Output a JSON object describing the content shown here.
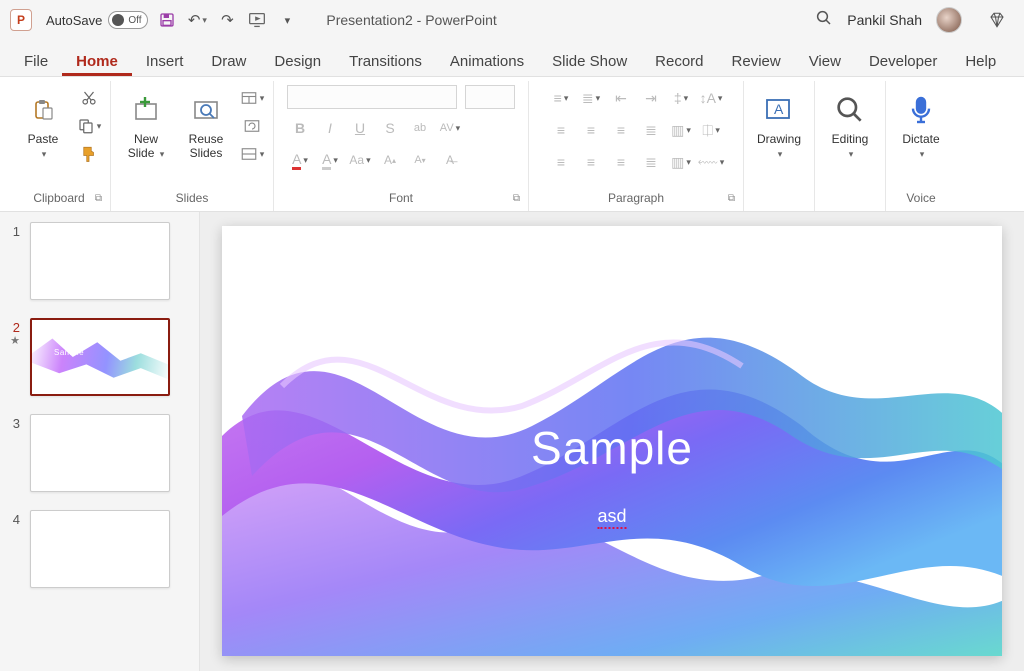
{
  "titlebar": {
    "autosave_label": "AutoSave",
    "autosave_state": "Off",
    "doc_title": "Presentation2  -  PowerPoint",
    "user_name": "Pankil Shah"
  },
  "tabs": [
    {
      "label": "File"
    },
    {
      "label": "Home",
      "active": true
    },
    {
      "label": "Insert"
    },
    {
      "label": "Draw"
    },
    {
      "label": "Design"
    },
    {
      "label": "Transitions"
    },
    {
      "label": "Animations"
    },
    {
      "label": "Slide Show"
    },
    {
      "label": "Record"
    },
    {
      "label": "Review"
    },
    {
      "label": "View"
    },
    {
      "label": "Developer"
    },
    {
      "label": "Help"
    }
  ],
  "ribbon": {
    "clipboard": {
      "paste": "Paste",
      "group_label": "Clipboard"
    },
    "slides": {
      "new_slide": "New\nSlide",
      "reuse": "Reuse\nSlides",
      "group_label": "Slides"
    },
    "font": {
      "group_label": "Font"
    },
    "paragraph": {
      "group_label": "Paragraph"
    },
    "drawing": {
      "label": "Drawing"
    },
    "editing": {
      "label": "Editing"
    },
    "voice": {
      "dictate": "Dictate",
      "group_label": "Voice"
    }
  },
  "thumbnails": [
    {
      "num": "1"
    },
    {
      "num": "2",
      "selected": true,
      "design": true,
      "mini_title": "Sample"
    },
    {
      "num": "3"
    },
    {
      "num": "4"
    }
  ],
  "slide": {
    "title": "Sample",
    "subtitle": "asd"
  }
}
